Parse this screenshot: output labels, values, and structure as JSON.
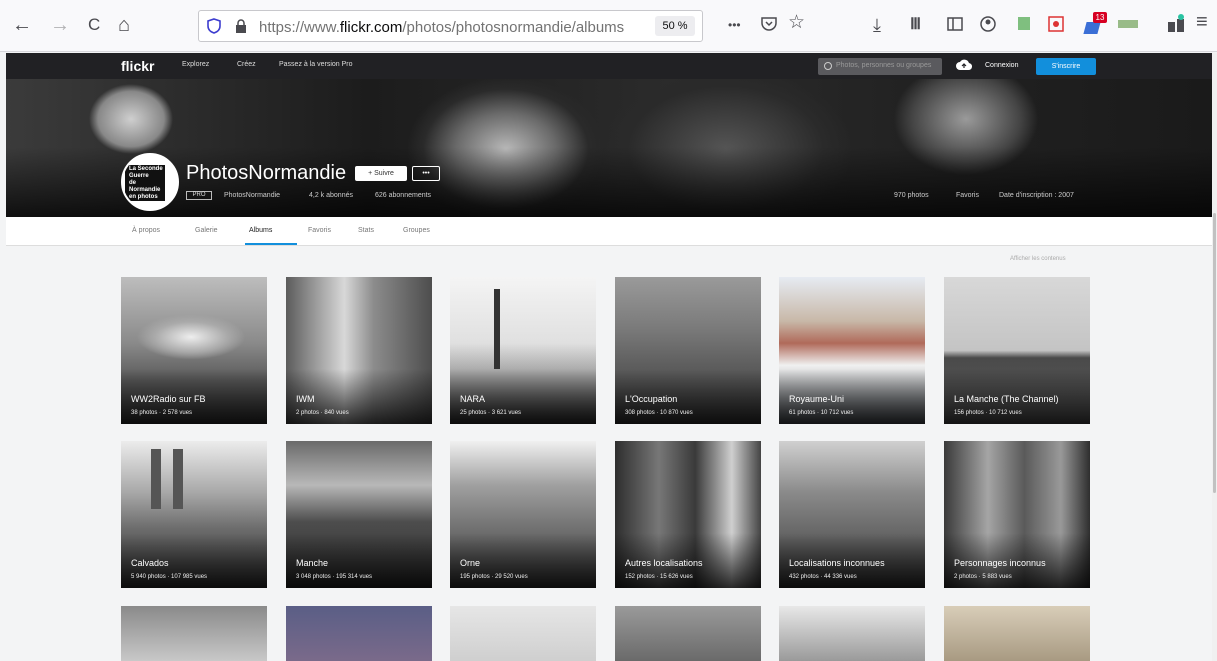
{
  "browser": {
    "url_prefix": "https://www.",
    "url_domain": "flickr.com",
    "url_path": "/photos/photosnormandie/albums",
    "zoom": "50 %",
    "back_icon": "←",
    "forward_icon": "→",
    "reload_icon": "C",
    "home_icon": "⌂",
    "more_icon": "•••",
    "star_icon": "☆",
    "download_icon": "⤓",
    "library_icon": "Ⅲ",
    "menu_icon": "≡",
    "badge": "13"
  },
  "flickr": {
    "logo": "flickr",
    "links": [
      "Explorez",
      "Créez",
      "Passez à la version Pro"
    ],
    "search_placeholder": "Photos, personnes ou groupes",
    "connect": "Connexion",
    "signup": "S'inscrire"
  },
  "profile": {
    "avatar_text": [
      "La Seconde",
      "Guerre",
      "de",
      "Normandie",
      "en photos"
    ],
    "name": "PhotosNormandie",
    "follow": "+ Suivre",
    "more": "•••",
    "pro_badge": "PRO",
    "username": "PhotosNormandie",
    "followers": "4,2 k abonnés",
    "following": "626 abonnements",
    "photos": "970 photos",
    "favorites": "Favoris",
    "joined": "Date d'inscription : 2007"
  },
  "tabs": [
    "À propos",
    "Galerie",
    "Albums",
    "Favoris",
    "Stats",
    "Groupes"
  ],
  "active_tab": "Albums",
  "showcase_link": "Afficher les contenus",
  "albums": [
    {
      "title": "WW2Radio sur FB",
      "stats": "38 photos · 2 578 vues"
    },
    {
      "title": "IWM",
      "stats": "2 photos · 840 vues"
    },
    {
      "title": "NARA",
      "stats": "25 photos · 3 621 vues"
    },
    {
      "title": "L'Occupation",
      "stats": "308 photos · 10 870 vues"
    },
    {
      "title": "Royaume-Uni",
      "stats": "61 photos · 10 712 vues"
    },
    {
      "title": "La Manche (The Channel)",
      "stats": "156 photos · 10 712 vues"
    },
    {
      "title": "Calvados",
      "stats": "5 940 photos · 107 985 vues"
    },
    {
      "title": "Manche",
      "stats": "3 048 photos · 195 314 vues"
    },
    {
      "title": "Orne",
      "stats": "195 photos · 29 520 vues"
    },
    {
      "title": "Autres localisations",
      "stats": "152 photos · 15 626 vues"
    },
    {
      "title": "Localisations inconnues",
      "stats": "432 photos · 44 336 vues"
    },
    {
      "title": "Personnages inconnus",
      "stats": "2 photos · 5 883 vues"
    }
  ]
}
